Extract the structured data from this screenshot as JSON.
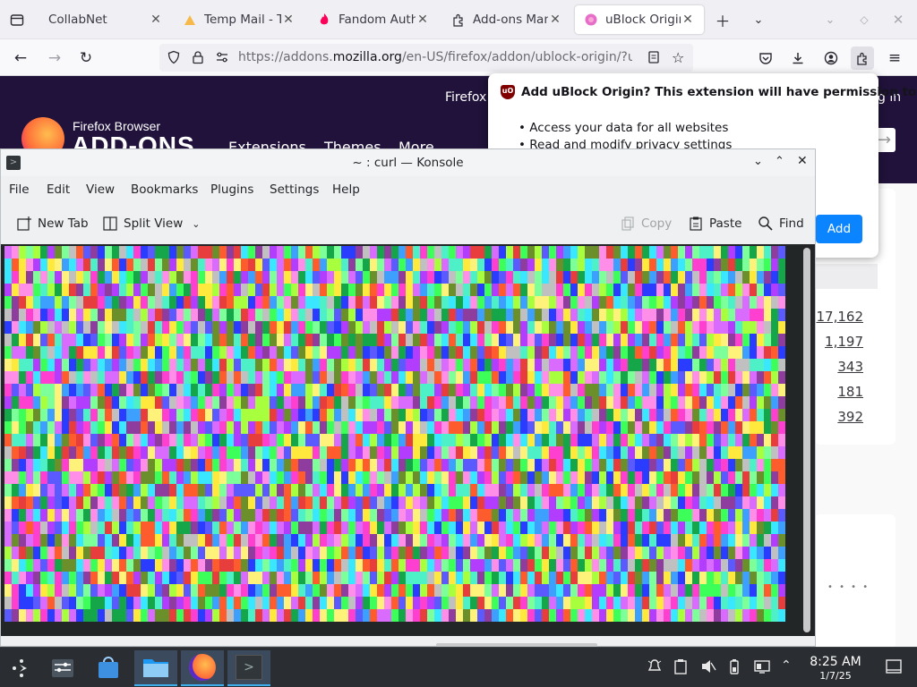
{
  "browser": {
    "tabs": [
      {
        "label": "CollabNet",
        "icon": "blank-page-icon"
      },
      {
        "label": "Temp Mail - Te",
        "icon": "temp-mail-icon"
      },
      {
        "label": "Fandom Auth",
        "icon": "fandom-flame-icon"
      },
      {
        "label": "Add-ons Mana",
        "icon": "puzzle-piece-icon"
      },
      {
        "label": "uBlock Origin",
        "icon": "firefox-addons-icon",
        "active": true
      }
    ],
    "url_prefix": "https://addons.",
    "url_domain": "mozilla.org",
    "url_rest": "/en-US/firefox/addon/ublock-origin/?utm"
  },
  "amo": {
    "brand_top": "Firefox Browser",
    "brand_bottom": "ADD-ONS",
    "nav_extensions": "Extensions",
    "nav_themes": "Themes",
    "nav_more": "More",
    "top_link": "Firefox",
    "login": "g in",
    "ratings": [
      "17,162",
      "1,197",
      "343",
      "181",
      "392"
    ]
  },
  "permission_popup": {
    "title": "Add uBlock Origin? This extension will have permission to:",
    "items": [
      "Access your data for all websites",
      "Read and modify privacy settings"
    ],
    "add_label": "Add"
  },
  "konsole": {
    "title": "~ : curl — Konsole",
    "menu": [
      "File",
      "Edit",
      "View",
      "Bookmarks",
      "Plugins",
      "Settings",
      "Help"
    ],
    "toolbar": {
      "new_tab": "New Tab",
      "split_view": "Split View",
      "copy": "Copy",
      "paste": "Paste",
      "find": "Find"
    }
  },
  "taskbar": {
    "time": "8:25 AM",
    "date": "1/7/25"
  },
  "colors": {
    "amo_header": "#20123a",
    "add_button": "#0a84ff",
    "terminal_bg": "#232627"
  }
}
